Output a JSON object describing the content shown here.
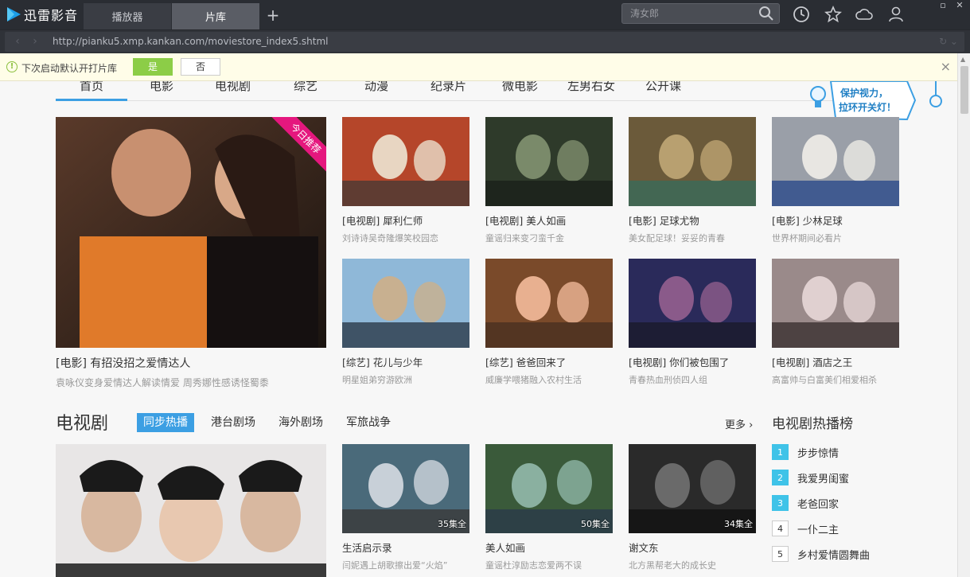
{
  "app": {
    "name": "迅雷影音"
  },
  "tabs": [
    {
      "label": "播放器"
    },
    {
      "label": "片库"
    }
  ],
  "search": {
    "placeholder": "涛女郎"
  },
  "address": {
    "url": "http://pianku5.xmp.kankan.com/moviestore_index5.shtml"
  },
  "notice": {
    "text": "下次启动默认开打片库",
    "yes": "是",
    "no": "否"
  },
  "nav": [
    {
      "label": "首页"
    },
    {
      "label": "电影"
    },
    {
      "label": "电视剧"
    },
    {
      "label": "综艺"
    },
    {
      "label": "动漫"
    },
    {
      "label": "纪录片"
    },
    {
      "label": "微电影"
    },
    {
      "label": "左男右女"
    },
    {
      "label": "公开课"
    }
  ],
  "lamp": {
    "text1": "保护视力，",
    "text2": "拉环开关灯！"
  },
  "hero": {
    "ribbon": "今日推荐",
    "title": "[电影] 有招没招之爱情达人",
    "subtitle": "袁咏仪变身爱情达人解读情爱 周秀娜性感诱怪蜀黍"
  },
  "cards": [
    {
      "title": "[电视剧] 犀利仁师",
      "subtitle": "刘诗诗吴奇隆爆笑校园恋",
      "colors": [
        "#b5462a",
        "#e8d6c2",
        "#4a3a34"
      ]
    },
    {
      "title": "[电视剧] 美人如画",
      "subtitle": "童谣归来变刁蛮千金",
      "colors": [
        "#2e3a2a",
        "#7a8a6a",
        "#1a201a"
      ]
    },
    {
      "title": "[电影] 足球尤物",
      "subtitle": "美女配足球！妥妥的青春",
      "colors": [
        "#6b5a3a",
        "#b8a070",
        "#3a6a5a"
      ]
    },
    {
      "title": "[电影] 少林足球",
      "subtitle": "世界杯期间必看片",
      "colors": [
        "#9a9fa8",
        "#e8e6e2",
        "#2a4a8a"
      ]
    },
    {
      "title": "[综艺] 花儿与少年",
      "subtitle": "明星姐弟穷游欧洲",
      "colors": [
        "#8fb8d8",
        "#c8b090",
        "#2a3a4a"
      ]
    },
    {
      "title": "[综艺] 爸爸回来了",
      "subtitle": "威廉学喂猪融入农村生活",
      "colors": [
        "#7a4a2a",
        "#e8b090",
        "#4a3020"
      ]
    },
    {
      "title": "[电视剧] 你们被包围了",
      "subtitle": "青春热血刑侦四人组",
      "colors": [
        "#2a2a5a",
        "#8a5a8a",
        "#1a1a2a"
      ]
    },
    {
      "title": "[电视剧] 酒店之王",
      "subtitle": "高富帅与白富美们相爱相杀",
      "colors": [
        "#9a8a8a",
        "#e0d0d0",
        "#3a3030"
      ]
    }
  ],
  "section": {
    "title": "电视剧",
    "tabs": [
      {
        "label": "同步热播"
      },
      {
        "label": "港台剧场"
      },
      {
        "label": "海外剧场"
      },
      {
        "label": "军旅战争"
      }
    ],
    "more": "更多 ›"
  },
  "tv_cards": [
    {
      "title": "生活启示录",
      "subtitle": "闫妮遇上胡歌擦出爱“火焰”",
      "episodes": "35集全",
      "colors": [
        "#4a6a7a",
        "#c8d0d8",
        "#3a3a3a"
      ]
    },
    {
      "title": "美人如画",
      "subtitle": "童谣杜淳励志恋爱两不误",
      "episodes": "50集全",
      "colors": [
        "#3a5a3a",
        "#8ab0a0",
        "#2a3a4a"
      ]
    },
    {
      "title": "谢文东",
      "subtitle": "北方黑帮老大的成长史",
      "episodes": "34集全",
      "colors": [
        "#2a2a2a",
        "#6a6a6a",
        "#111111"
      ]
    }
  ],
  "ranking": {
    "title": "电视剧热播榜",
    "items": [
      {
        "num": "1",
        "label": "步步惊情"
      },
      {
        "num": "2",
        "label": "我爱男闺蜜"
      },
      {
        "num": "3",
        "label": "老爸回家"
      },
      {
        "num": "4",
        "label": "一仆二主"
      },
      {
        "num": "5",
        "label": "乡村爱情圆舞曲"
      }
    ]
  }
}
